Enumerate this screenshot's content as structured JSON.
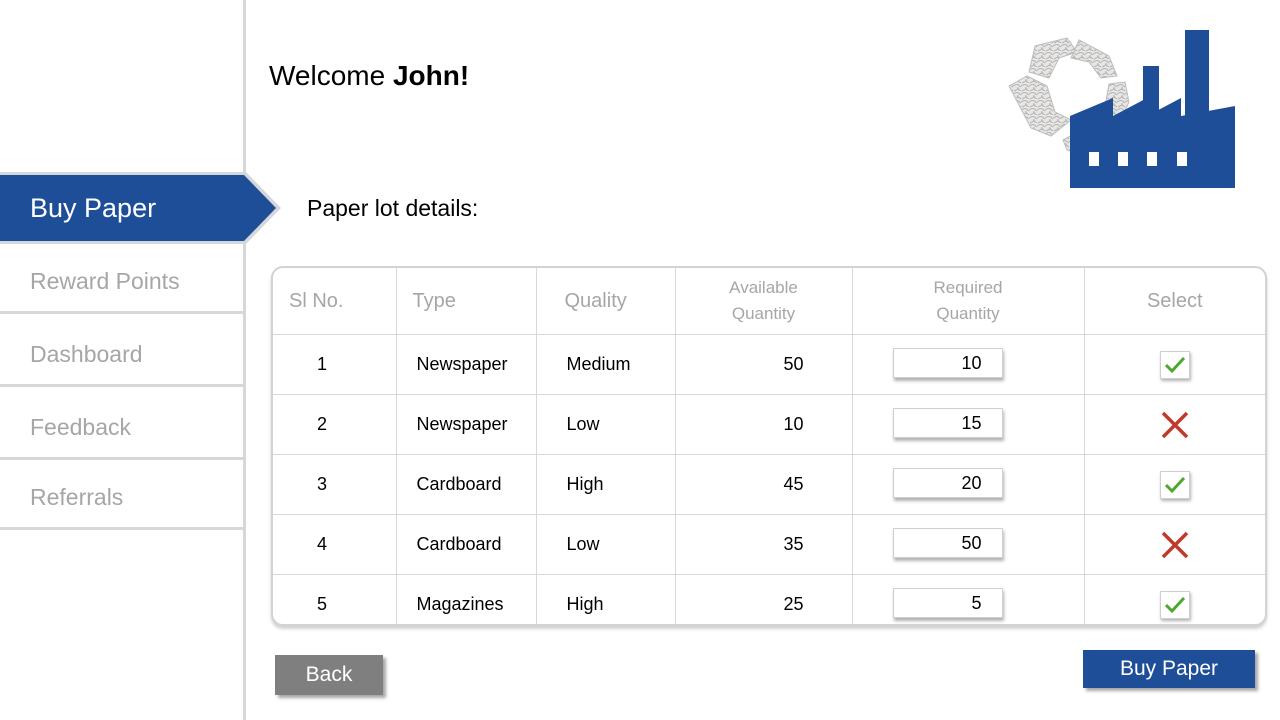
{
  "header": {
    "welcome_prefix": "Welcome",
    "welcome_name": "John!"
  },
  "sidebar": {
    "active_item": "Buy Paper",
    "items": [
      {
        "label": "Buy Paper"
      },
      {
        "label": "Reward Points"
      },
      {
        "label": "Dashboard"
      },
      {
        "label": "Feedback"
      },
      {
        "label": "Referrals"
      }
    ]
  },
  "section_title": "Paper lot details:",
  "table": {
    "headers": {
      "sl": "Sl No.",
      "type": "Type",
      "quality": "Quality",
      "available_1": "Available",
      "available_2": "Quantity",
      "required_1": "Required",
      "required_2": "Quantity",
      "select": "Select"
    },
    "rows": [
      {
        "sl": "1",
        "type": "Newspaper",
        "quality": "Medium",
        "available": "50",
        "required": "10",
        "selected": true
      },
      {
        "sl": "2",
        "type": "Newspaper",
        "quality": "Low",
        "available": "10",
        "required": "15",
        "selected": false
      },
      {
        "sl": "3",
        "type": "Cardboard",
        "quality": "High",
        "available": "45",
        "required": "20",
        "selected": true
      },
      {
        "sl": "4",
        "type": "Cardboard",
        "quality": "Low",
        "available": "35",
        "required": "50",
        "selected": false
      },
      {
        "sl": "5",
        "type": "Magazines",
        "quality": "High",
        "available": "25",
        "required": "5",
        "selected": true
      }
    ]
  },
  "buttons": {
    "back": "Back",
    "buy": "Buy Paper"
  },
  "icons": {
    "selected": "check-icon",
    "not_selected": "cross-icon",
    "logo": "recycle-factory-logo"
  },
  "colors": {
    "brand": "#1f4e99",
    "check": "#4ea72e",
    "cross": "#c0392b",
    "back_button": "#7f7f7f",
    "muted_text": "#a6a6a6"
  }
}
